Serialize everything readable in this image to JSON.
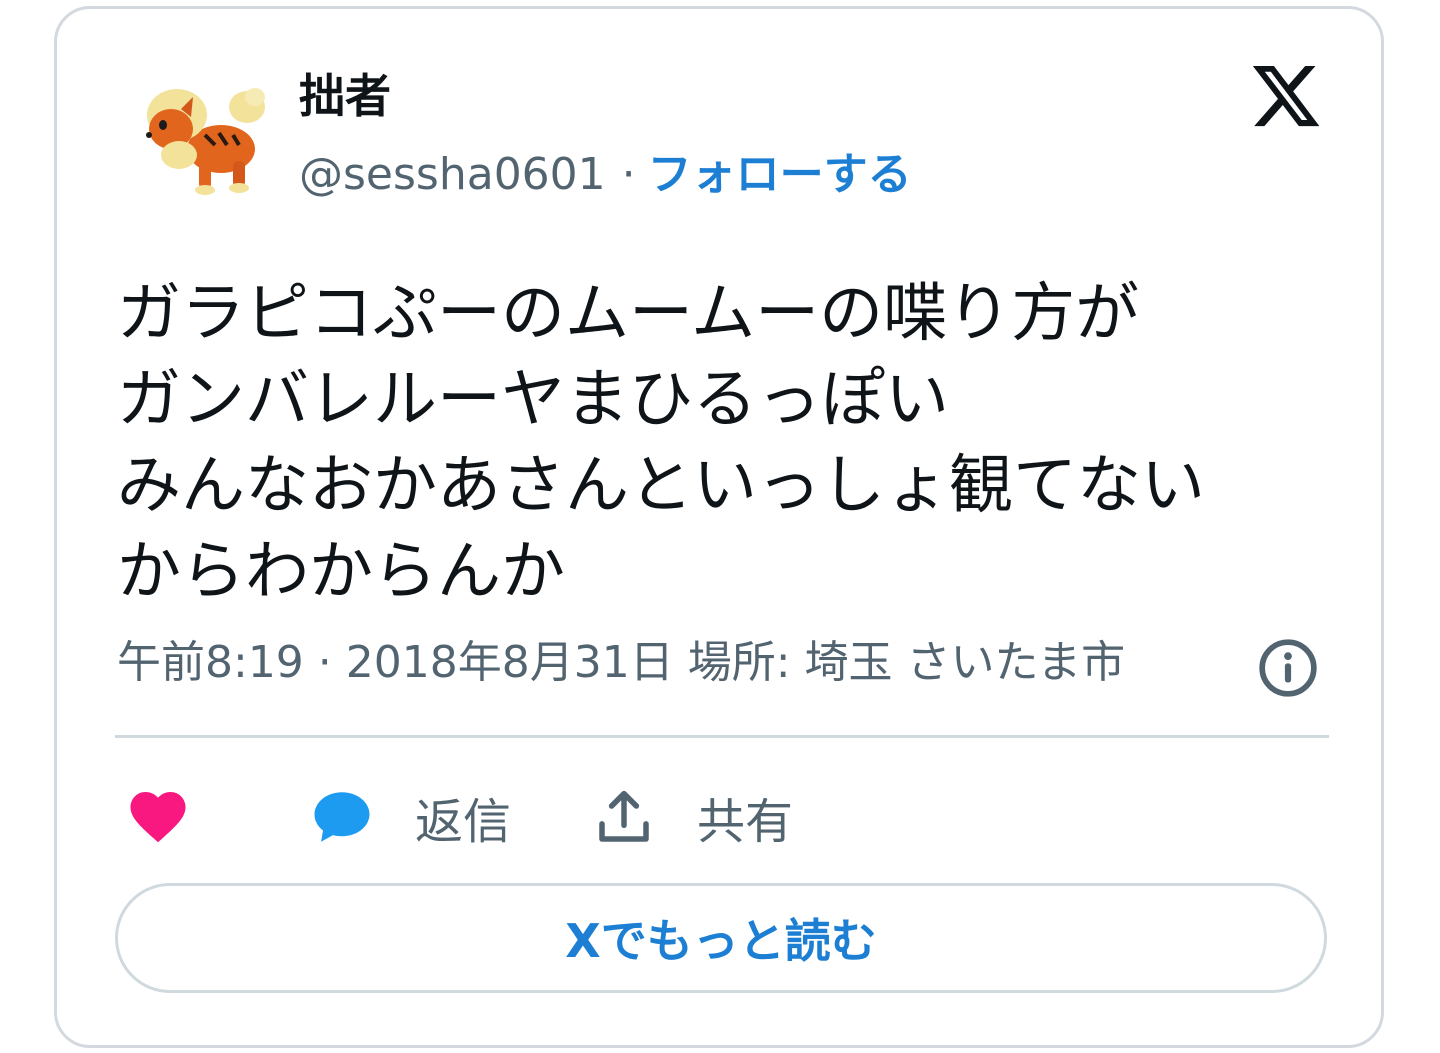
{
  "user": {
    "display_name": "拙者",
    "handle": "@sessha0601",
    "separator": "·",
    "follow_label": "フォローする"
  },
  "tweet": {
    "text": "ガラピコぷーのムームーの喋り方が\nガンバレルーヤまひるっぽい\nみんなおかあさんといっしょ観てない\nからわからんか",
    "meta": "午前8:19 · 2018年8月31日 場所: 埼玉 さいたま市"
  },
  "actions": {
    "reply_label": "返信",
    "share_label": "共有"
  },
  "read_more_label": "Xでもっと読む",
  "icons": {
    "avatar": "growlithe-avatar",
    "logo": "x-logo-icon",
    "info": "info-icon",
    "like": "heart-icon",
    "reply": "speech-bubble-icon",
    "share": "share-upload-icon"
  },
  "colors": {
    "accent": "#1d7fd3",
    "secondary_text": "#536471",
    "heart": "#f91880",
    "reply_bubble": "#1d9bf0"
  }
}
